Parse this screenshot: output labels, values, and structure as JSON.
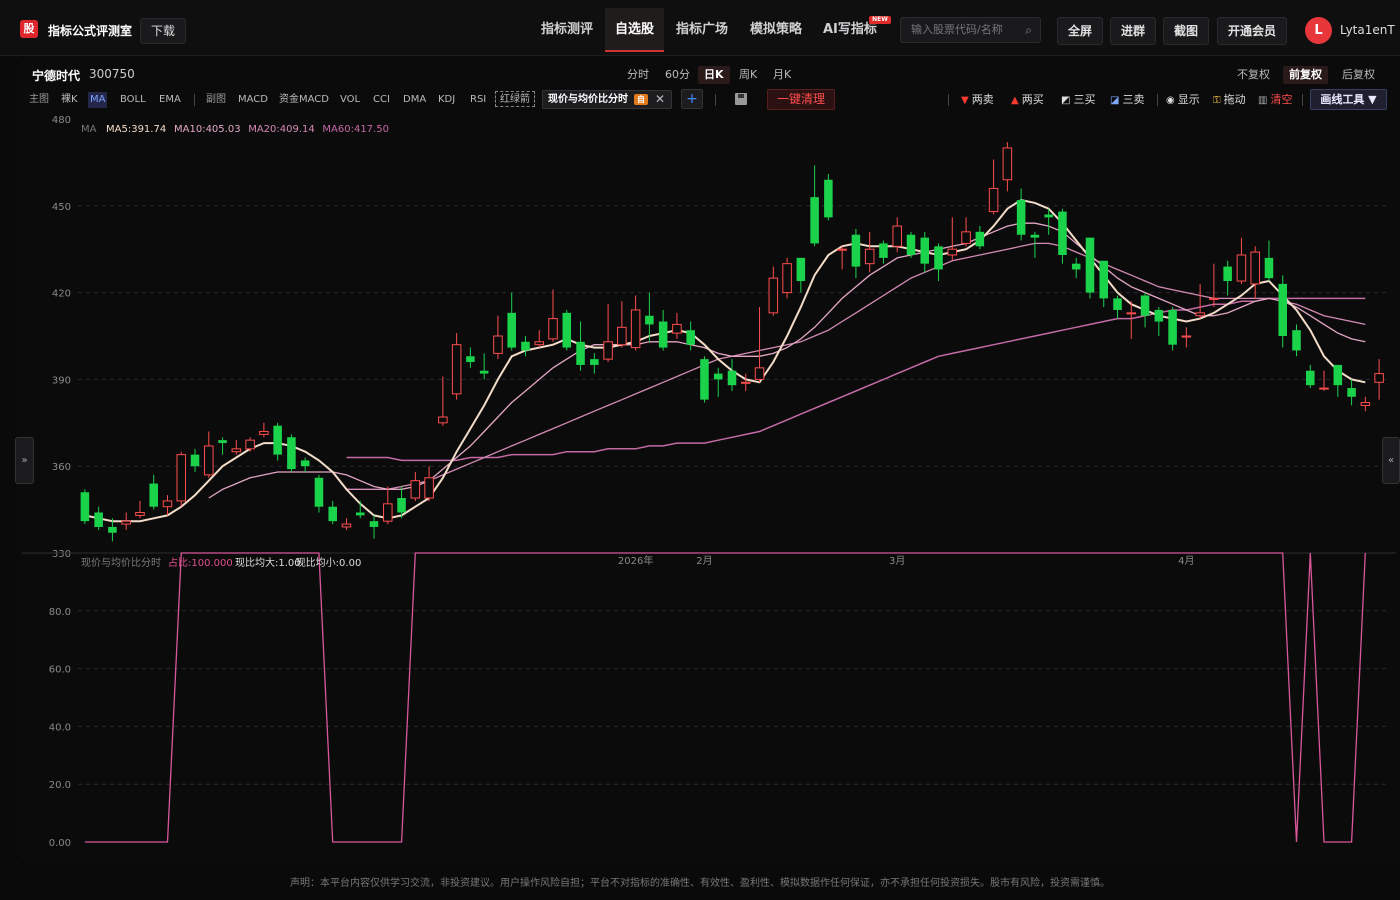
{
  "header": {
    "logo_char": "股",
    "brand": "指标公式评测室",
    "download": "下载",
    "nav": [
      "指标测评",
      "自选股",
      "指标广场",
      "模拟策略",
      "AI写指标"
    ],
    "nav_active_index": 1,
    "new_badge": "NEW",
    "search_placeholder": "输入股票代码/名称",
    "buttons": [
      "全屏",
      "进群",
      "截图",
      "开通会员"
    ],
    "avatar_letter": "L",
    "username": "Lyta1enT"
  },
  "stock": {
    "name": "宁德时代",
    "code": "300750"
  },
  "periods": [
    "分时",
    "60分",
    "日K",
    "周K",
    "月K"
  ],
  "period_active": "日K",
  "fuquan": [
    "不复权",
    "前复权",
    "后复权"
  ],
  "fuquan_active": "前复权",
  "indicators": {
    "main_label": "主图",
    "main": [
      "裸K",
      "MA",
      "BOLL",
      "EMA"
    ],
    "main_active": "MA",
    "sub_label": "副图",
    "sub": [
      "MACD",
      "资金MACD",
      "VOL",
      "CCI",
      "DMA",
      "KDJ",
      "RSI"
    ],
    "red_green": "红绿箭",
    "formula_tab": "现价与均价比分时",
    "formula_badge": "自",
    "plus": "+",
    "clear_btn": "一键清理"
  },
  "draw_tools": [
    {
      "label": "两卖",
      "icon": "down-triangle-icon",
      "glyph": "▼",
      "color": "#ff3b30"
    },
    {
      "label": "两买",
      "icon": "up-triangle-icon",
      "glyph": "▲",
      "color": "#ff3b30"
    },
    {
      "label": "三买",
      "icon": "chart-up-icon",
      "glyph": "◩",
      "color": "#dddddd"
    },
    {
      "label": "三卖",
      "icon": "chart-down-icon",
      "glyph": "◪",
      "color": "#dddddd"
    },
    {
      "label": "显示",
      "icon": "eye-icon",
      "glyph": "◉",
      "color": "#dddddd"
    },
    {
      "label": "拖动",
      "icon": "lock-icon",
      "glyph": "⚿",
      "color": "#f0c040"
    },
    {
      "label": "清空",
      "icon": "trash-icon",
      "glyph": "▥",
      "color": "#ff4d4d"
    }
  ],
  "draw_tool_btn": "画线工具 ▼",
  "ma_legend": {
    "prefix": "MA",
    "items": [
      {
        "label": "MA5:391.74",
        "color": "#f3dcc8"
      },
      {
        "label": "MA10:405.03",
        "color": "#e3a7c4"
      },
      {
        "label": "MA20:409.14",
        "color": "#d48bb4"
      },
      {
        "label": "MA60:417.50",
        "color": "#c46aa4"
      }
    ]
  },
  "sub_legend": {
    "name": "现价与均价比分时",
    "items": [
      {
        "label": "占比:100.000",
        "color": "#e0508a"
      },
      {
        "label": "现比均大:1.00",
        "color": "#dddddd"
      },
      {
        "label": "现比均小:0.00",
        "color": "#dddddd"
      }
    ]
  },
  "chart_data": [
    {
      "type": "candlestick",
      "title": "宁德时代 300750 日K",
      "ylim": [
        330,
        480
      ],
      "y_ticks": [
        "480",
        "450",
        "420",
        "390",
        "360",
        "330"
      ],
      "x_labels": [
        "2026年",
        "2月",
        "3月",
        "4月"
      ],
      "x_label_index": [
        40,
        45,
        59,
        80
      ],
      "up_color": "#ff4d4d",
      "down_color": "#1bd34b",
      "candles": [
        [
          351,
          341,
          352,
          340
        ],
        [
          344,
          339,
          346,
          338
        ],
        [
          339,
          337,
          342,
          334
        ],
        [
          340,
          341,
          344,
          338
        ],
        [
          343,
          344,
          348,
          342
        ],
        [
          354,
          346,
          357,
          345
        ],
        [
          346,
          348,
          350,
          343
        ],
        [
          348,
          364,
          365,
          346
        ],
        [
          364,
          360,
          366,
          358
        ],
        [
          357,
          367,
          372,
          356
        ],
        [
          369,
          368,
          370,
          364
        ],
        [
          365,
          366,
          369,
          364
        ],
        [
          366,
          369,
          370,
          365
        ],
        [
          371,
          372,
          375,
          370
        ],
        [
          374,
          364,
          375,
          362
        ],
        [
          370,
          359,
          371,
          358
        ],
        [
          362,
          360,
          363,
          358
        ],
        [
          356,
          346,
          357,
          344
        ],
        [
          346,
          341,
          348,
          340
        ],
        [
          339,
          340,
          342,
          338
        ],
        [
          344,
          343,
          348,
          342
        ],
        [
          341,
          339,
          343,
          335
        ],
        [
          341,
          347,
          353,
          340
        ],
        [
          349,
          344,
          353,
          342
        ],
        [
          349,
          355,
          358,
          348
        ],
        [
          349,
          356,
          360,
          348
        ],
        [
          375,
          377,
          391,
          374
        ],
        [
          385,
          402,
          406,
          383
        ],
        [
          398,
          396,
          401,
          394
        ],
        [
          393,
          392,
          399,
          390
        ],
        [
          399,
          405,
          412,
          397
        ],
        [
          413,
          401,
          420,
          400
        ],
        [
          403,
          400,
          405,
          398
        ],
        [
          402,
          403,
          407,
          401
        ],
        [
          404,
          411,
          421,
          403
        ],
        [
          413,
          401,
          414,
          400
        ],
        [
          403,
          395,
          410,
          393
        ],
        [
          397,
          395,
          399,
          392
        ],
        [
          397,
          403,
          416,
          396
        ],
        [
          402,
          408,
          417,
          401
        ],
        [
          401,
          414,
          419,
          400
        ],
        [
          412,
          409,
          420,
          403
        ],
        [
          410,
          401,
          414,
          400
        ],
        [
          406,
          409,
          413,
          404
        ],
        [
          407,
          402,
          410,
          400
        ],
        [
          397,
          383,
          398,
          382
        ],
        [
          392,
          390,
          394,
          384
        ],
        [
          393,
          388,
          397,
          386
        ],
        [
          389,
          389,
          392,
          386
        ],
        [
          390,
          394,
          415,
          389
        ],
        [
          413,
          425,
          429,
          412
        ],
        [
          420,
          430,
          432,
          418
        ],
        [
          432,
          424,
          432,
          420
        ],
        [
          453,
          437,
          464,
          436
        ],
        [
          459,
          446,
          461,
          445
        ],
        [
          435,
          435,
          436,
          428
        ],
        [
          440,
          429,
          442,
          425
        ],
        [
          430,
          435,
          441,
          427
        ],
        [
          437,
          432,
          438,
          430
        ],
        [
          436,
          443,
          446,
          434
        ],
        [
          440,
          433,
          441,
          432
        ],
        [
          439,
          430,
          441,
          427
        ],
        [
          436,
          428,
          437,
          424
        ],
        [
          433,
          435,
          446,
          431
        ],
        [
          437,
          441,
          446,
          436
        ],
        [
          441,
          436,
          443,
          435
        ],
        [
          448,
          456,
          466,
          447
        ],
        [
          459,
          470,
          472,
          455
        ],
        [
          452,
          440,
          456,
          438
        ],
        [
          440,
          439,
          441,
          432
        ],
        [
          447,
          446,
          449,
          440
        ],
        [
          448,
          433,
          449,
          430
        ],
        [
          430,
          428,
          432,
          425
        ],
        [
          439,
          420,
          439,
          418
        ],
        [
          431,
          418,
          431,
          415
        ],
        [
          418,
          414,
          419,
          411
        ],
        [
          413,
          413,
          417,
          404
        ],
        [
          419,
          412,
          420,
          408
        ],
        [
          414,
          410,
          415,
          405
        ],
        [
          414,
          402,
          415,
          400
        ],
        [
          405,
          405,
          408,
          401
        ],
        [
          412,
          413,
          423,
          411
        ],
        [
          418,
          418,
          430,
          415
        ],
        [
          429,
          424,
          431,
          419
        ],
        [
          424,
          433,
          439,
          423
        ],
        [
          423,
          434,
          436,
          418
        ],
        [
          432,
          425,
          438,
          424
        ],
        [
          423,
          405,
          426,
          401
        ],
        [
          407,
          400,
          409,
          398
        ],
        [
          393,
          388,
          395,
          387
        ],
        [
          387,
          387,
          393,
          386
        ],
        [
          395,
          388,
          395,
          384
        ],
        [
          387,
          384,
          390,
          381
        ],
        [
          381,
          382,
          384,
          379
        ],
        [
          389,
          392,
          397,
          383
        ]
      ],
      "ma": {
        "MA5": [
          343,
          342,
          341,
          341,
          341,
          342,
          343,
          346,
          350,
          355,
          360,
          363,
          366,
          368,
          368,
          367,
          365,
          362,
          358,
          352,
          347,
          343,
          342,
          343,
          346,
          349,
          356,
          365,
          373,
          381,
          390,
          398,
          400,
          401,
          402,
          404,
          402,
          401,
          401,
          402,
          403,
          405,
          406,
          407,
          406,
          402,
          397,
          393,
          390,
          389,
          396,
          405,
          415,
          426,
          433,
          436,
          437,
          436,
          436,
          436,
          435,
          434,
          433,
          434,
          435,
          438,
          443,
          449,
          452,
          451,
          449,
          444,
          438,
          432,
          426,
          420,
          416,
          414,
          412,
          411,
          410,
          411,
          413,
          416,
          419,
          423,
          424,
          419,
          414,
          407,
          398,
          393,
          390,
          389
        ],
        "MA10": [
          null,
          null,
          null,
          null,
          null,
          null,
          null,
          null,
          null,
          349,
          352,
          354,
          356,
          357,
          358,
          358,
          358,
          358,
          358,
          357,
          355,
          353,
          352,
          352,
          353,
          355,
          359,
          363,
          367,
          372,
          377,
          382,
          386,
          390,
          394,
          397,
          400,
          402,
          402,
          402,
          402,
          403,
          403,
          403,
          402,
          401,
          399,
          398,
          398,
          398,
          399,
          401,
          404,
          408,
          413,
          418,
          422,
          426,
          429,
          432,
          433,
          434,
          435,
          436,
          437,
          439,
          441,
          443,
          444,
          444,
          443,
          441,
          437,
          433,
          429,
          425,
          422,
          420,
          418,
          416,
          414,
          412,
          412,
          413,
          415,
          417,
          418,
          417,
          415,
          412,
          409,
          406,
          404,
          403
        ],
        "MA20": [
          null,
          null,
          null,
          null,
          null,
          null,
          null,
          null,
          null,
          null,
          null,
          null,
          null,
          null,
          null,
          null,
          null,
          null,
          null,
          352,
          352,
          352,
          352,
          353,
          354,
          355,
          357,
          359,
          361,
          363,
          365,
          367,
          369,
          371,
          373,
          375,
          377,
          379,
          381,
          383,
          385,
          387,
          389,
          391,
          393,
          395,
          397,
          398,
          399,
          400,
          401,
          402,
          403,
          405,
          407,
          410,
          413,
          416,
          419,
          422,
          425,
          427,
          429,
          431,
          432,
          433,
          434,
          435,
          436,
          437,
          437,
          436,
          434,
          432,
          430,
          428,
          426,
          424,
          422,
          421,
          420,
          419,
          418,
          418,
          418,
          418,
          418,
          417,
          416,
          414,
          412,
          411,
          410,
          409
        ],
        "MA60": [
          null,
          null,
          null,
          null,
          null,
          null,
          null,
          null,
          null,
          null,
          null,
          null,
          null,
          null,
          null,
          null,
          null,
          null,
          null,
          363,
          363,
          363,
          363,
          362,
          362,
          362,
          362,
          362,
          363,
          363,
          363,
          364,
          364,
          364,
          364,
          365,
          365,
          365,
          366,
          366,
          366,
          367,
          367,
          368,
          368,
          368,
          369,
          370,
          371,
          372,
          374,
          376,
          378,
          380,
          382,
          384,
          386,
          388,
          390,
          392,
          394,
          396,
          398,
          399,
          400,
          401,
          402,
          403,
          404,
          405,
          406,
          407,
          408,
          409,
          410,
          411,
          411,
          412,
          413,
          414,
          414,
          415,
          416,
          416,
          417,
          417,
          418,
          418,
          418,
          418,
          418,
          418,
          418,
          418
        ]
      }
    },
    {
      "type": "line",
      "title": "现价与均价比分时",
      "ylim": [
        0,
        100
      ],
      "y_ticks": [
        "80.0",
        "60.0",
        "40.0",
        "20.0",
        "0.00"
      ],
      "series": [
        {
          "name": "占比",
          "values": [
            0,
            0,
            0,
            0,
            0,
            0,
            0,
            100,
            100,
            100,
            100,
            100,
            100,
            100,
            100,
            100,
            100,
            100,
            0,
            0,
            0,
            0,
            0,
            0,
            100,
            100,
            100,
            100,
            100,
            100,
            100,
            100,
            100,
            100,
            100,
            100,
            100,
            100,
            100,
            100,
            100,
            100,
            100,
            100,
            100,
            100,
            100,
            100,
            100,
            100,
            100,
            100,
            100,
            100,
            100,
            100,
            100,
            100,
            100,
            100,
            100,
            100,
            100,
            100,
            100,
            100,
            100,
            100,
            100,
            100,
            100,
            100,
            100,
            100,
            100,
            100,
            100,
            100,
            100,
            100,
            100,
            100,
            100,
            100,
            100,
            100,
            100,
            100,
            0,
            100,
            0,
            0,
            0,
            100
          ]
        }
      ]
    }
  ],
  "disclaimer": "声明：本平台内容仅供学习交流，非投资建议。用户操作风险自担；平台不对指标的准确性、有效性、盈利性、模拟数据作任何保证，亦不承担任何投资损失。股市有风险，投资需谨慎。"
}
